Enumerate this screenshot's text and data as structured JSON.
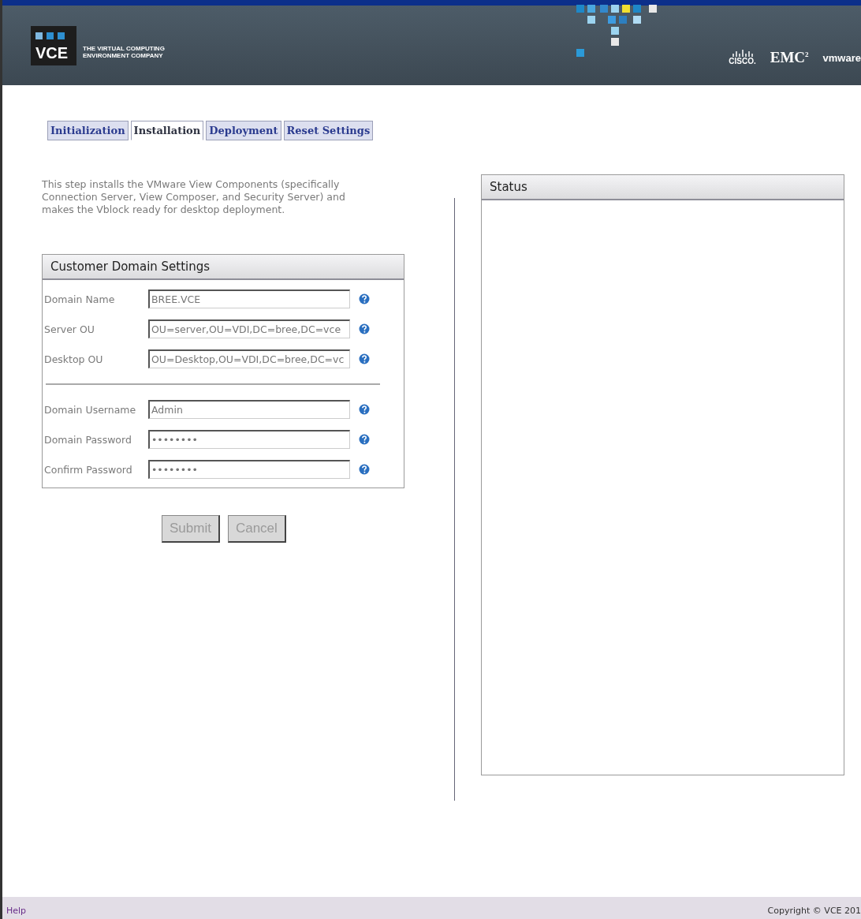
{
  "header": {
    "logo": {
      "mark": "VCE",
      "line_1": "THE VIRTUAL COMPUTING",
      "line_2": "ENVIRONMENT COMPANY"
    },
    "partners": [
      {
        "kind": "cisco",
        "label": "CISCO."
      },
      {
        "kind": "emc",
        "label": "EMC",
        "sup": "2"
      },
      {
        "kind": "vmware",
        "label": "vmware"
      }
    ]
  },
  "tabs": [
    {
      "label": "Initialization",
      "selected": false
    },
    {
      "label": "Installation",
      "selected": true
    },
    {
      "label": "Deployment",
      "selected": false
    },
    {
      "label": "Reset Settings",
      "selected": false
    }
  ],
  "description": "This step installs the VMware View Components (specifically Connection Server, View Composer, and Security Server) and makes the Vblock ready for desktop deployment.",
  "settings": {
    "title": "Customer Domain Settings",
    "groups": [
      [
        {
          "label": "Domain Name",
          "value": "BREE.VCE"
        },
        {
          "label": "Server OU",
          "value": "OU=server,OU=VDI,DC=bree,DC=vce"
        },
        {
          "label": "Desktop OU",
          "value": "OU=Desktop,OU=VDI,DC=bree,DC=vc"
        }
      ],
      [
        {
          "label": "Domain Username",
          "value": "Admin"
        },
        {
          "label": "Domain Password",
          "value": "••••••••"
        },
        {
          "label": "Confirm Password",
          "value": "••••••••"
        }
      ]
    ]
  },
  "buttons": [
    "Submit",
    "Cancel"
  ],
  "status": {
    "title": "Status"
  },
  "footer": {
    "help": "Help",
    "copyright": "Copyright © VCE 201"
  }
}
